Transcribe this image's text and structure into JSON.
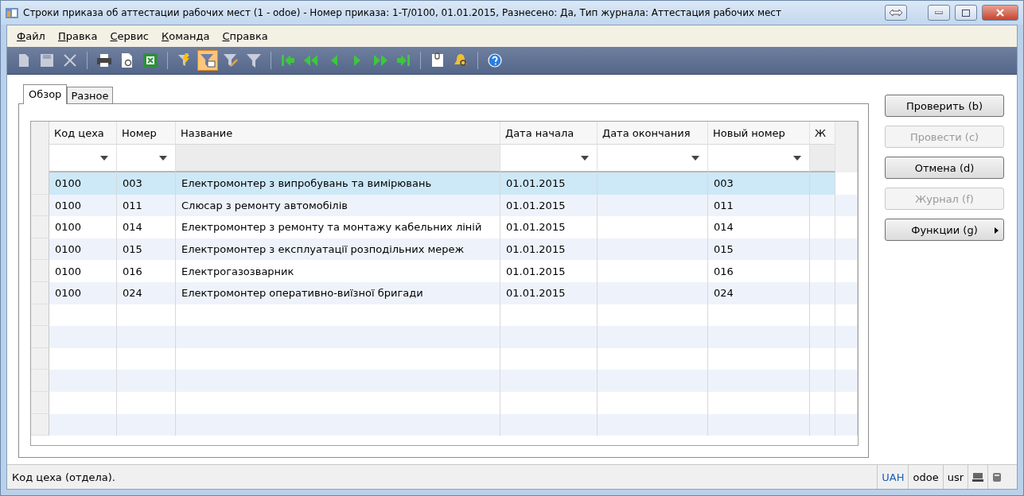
{
  "window": {
    "title": "Строки приказа об аттестации рабочих мест (1 - odoe) - Номер приказа: 1-Т/0100, 01.01.2015, Разнесено: Да, Тип журнала: Аттестация рабочих мест"
  },
  "menu": [
    {
      "label": "Файл"
    },
    {
      "label": "Правка"
    },
    {
      "label": "Сервис"
    },
    {
      "label": "Команда"
    },
    {
      "label": "Справка"
    }
  ],
  "toolbar": [
    {
      "kind": "new",
      "disabled": true,
      "selected": false
    },
    {
      "kind": "save",
      "disabled": true,
      "selected": false
    },
    {
      "kind": "delete",
      "disabled": true,
      "selected": false
    },
    {
      "kind": "separator"
    },
    {
      "kind": "print",
      "disabled": false,
      "selected": false
    },
    {
      "kind": "preview",
      "disabled": false,
      "selected": false
    },
    {
      "kind": "excel",
      "disabled": false,
      "selected": false
    },
    {
      "kind": "separator"
    },
    {
      "kind": "lightning",
      "disabled": false,
      "selected": false
    },
    {
      "kind": "filter-grid",
      "disabled": false,
      "selected": true
    },
    {
      "kind": "filter-edit",
      "disabled": false,
      "selected": false
    },
    {
      "kind": "filter",
      "disabled": false,
      "selected": false
    },
    {
      "kind": "separator"
    },
    {
      "kind": "first",
      "disabled": false,
      "selected": false
    },
    {
      "kind": "prev-page",
      "disabled": false,
      "selected": false
    },
    {
      "kind": "prev",
      "disabled": false,
      "selected": false
    },
    {
      "kind": "next",
      "disabled": false,
      "selected": false
    },
    {
      "kind": "next-page",
      "disabled": false,
      "selected": false
    },
    {
      "kind": "last",
      "disabled": false,
      "selected": false
    },
    {
      "kind": "separator"
    },
    {
      "kind": "document",
      "disabled": false,
      "selected": false
    },
    {
      "kind": "bell",
      "disabled": false,
      "selected": false
    },
    {
      "kind": "separator"
    },
    {
      "kind": "help",
      "disabled": false,
      "selected": false
    }
  ],
  "tabs": [
    {
      "label": "Обзор",
      "selected": true
    },
    {
      "label": "Разное",
      "selected": false
    }
  ],
  "table": {
    "columns": [
      "Код цеха",
      "Номер",
      "Название",
      "Дата начала",
      "Дата окончания",
      "Новый номер",
      "Ж"
    ],
    "filters": [
      true,
      true,
      false,
      true,
      true,
      true,
      false
    ],
    "rows": [
      {
        "selected": true,
        "cells": [
          "0100",
          "003",
          "Електромонтер з випробувань та вимірювань",
          "01.01.2015",
          "",
          "003",
          ""
        ]
      },
      {
        "selected": false,
        "cells": [
          "0100",
          "011",
          "Слюсар з ремонту автомобілів",
          "01.01.2015",
          "",
          "011",
          ""
        ]
      },
      {
        "selected": false,
        "cells": [
          "0100",
          "014",
          "Електромонтер з ремонту та монтажу кабельних ліній",
          "01.01.2015",
          "",
          "014",
          ""
        ]
      },
      {
        "selected": false,
        "cells": [
          "0100",
          "015",
          "Електромонтер з експлуатації розподільних мереж",
          "01.01.2015",
          "",
          "015",
          ""
        ]
      },
      {
        "selected": false,
        "cells": [
          "0100",
          "016",
          "Електрогазозварник",
          "01.01.2015",
          "",
          "016",
          ""
        ]
      },
      {
        "selected": false,
        "cells": [
          "0100",
          "024",
          "Електромонтер оперативно-виїзної бригади",
          "01.01.2015",
          "",
          "024",
          ""
        ]
      }
    ]
  },
  "buttons": [
    {
      "label": "Проверить (b)",
      "disabled": false,
      "submenu": false
    },
    {
      "label": "Провести (c)",
      "disabled": true,
      "submenu": false
    },
    {
      "label": "Отмена (d)",
      "disabled": false,
      "submenu": false
    },
    {
      "label": "Журнал (f)",
      "disabled": true,
      "submenu": false
    },
    {
      "label": "Функции (g)",
      "disabled": false,
      "submenu": true
    }
  ],
  "status_bar": {
    "text": "Код цеха (отдела).",
    "fields": [
      "UAH",
      "odoe",
      "usr"
    ]
  }
}
